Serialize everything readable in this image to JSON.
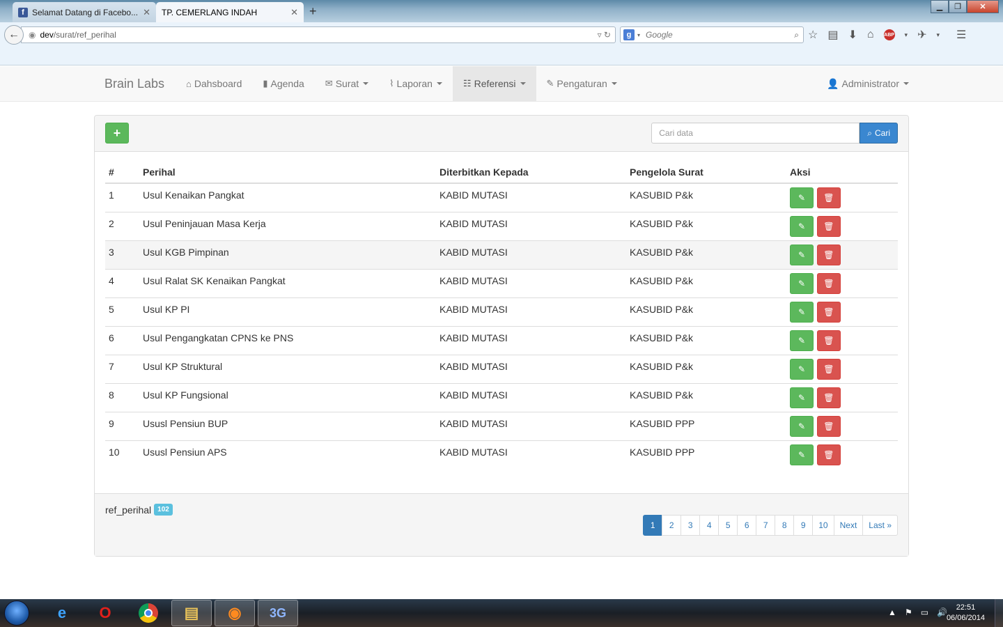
{
  "browser": {
    "tabs": [
      {
        "title": "Selamat Datang di Facebo...",
        "favicon": "facebook-icon"
      },
      {
        "title": "TP. CEMERLANG INDAH"
      }
    ],
    "new_tab": "+",
    "url_host": "dev",
    "url_path": "/surat/ref_perihal",
    "search_placeholder": "Google"
  },
  "app": {
    "brand": "Brain Labs",
    "nav": [
      {
        "label": "Dahsboard",
        "icon": "home-icon"
      },
      {
        "label": "Agenda",
        "icon": "book-icon"
      },
      {
        "label": "Surat",
        "icon": "envelope-icon",
        "dropdown": true
      },
      {
        "label": "Laporan",
        "icon": "paperclip-icon",
        "dropdown": true
      },
      {
        "label": "Referensi",
        "icon": "list-icon",
        "dropdown": true,
        "active": true
      },
      {
        "label": "Pengaturan",
        "icon": "wrench-icon",
        "dropdown": true
      }
    ],
    "user": "Administrator"
  },
  "toolbar": {
    "add_label": "+",
    "search_placeholder": "Cari data",
    "search_button": "Cari"
  },
  "table": {
    "headers": [
      "#",
      "Perihal",
      "Diterbitkan Kepada",
      "Pengelola Surat",
      "Aksi"
    ],
    "rows": [
      [
        "1",
        "Usul Kenaikan Pangkat",
        "KABID MUTASI",
        "KASUBID P&k"
      ],
      [
        "2",
        "Usul Peninjauan Masa Kerja",
        "KABID MUTASI",
        "KASUBID P&k"
      ],
      [
        "3",
        "Usul KGB Pimpinan",
        "KABID MUTASI",
        "KASUBID P&k"
      ],
      [
        "4",
        "Usul Ralat SK Kenaikan Pangkat",
        "KABID MUTASI",
        "KASUBID P&k"
      ],
      [
        "5",
        "Usul KP PI",
        "KABID MUTASI",
        "KASUBID P&k"
      ],
      [
        "6",
        "Usul Pengangkatan CPNS ke PNS",
        "KABID MUTASI",
        "KASUBID P&k"
      ],
      [
        "7",
        "Usul KP Struktural",
        "KABID MUTASI",
        "KASUBID P&k"
      ],
      [
        "8",
        "Usul KP Fungsional",
        "KABID MUTASI",
        "KASUBID P&k"
      ],
      [
        "9",
        "Ususl Pensiun BUP",
        "KABID MUTASI",
        "KASUBID PPP"
      ],
      [
        "10",
        "Ususl Pensiun APS",
        "KABID MUTASI",
        "KASUBID PPP"
      ]
    ]
  },
  "footer": {
    "label": "ref_perihal",
    "count": "102",
    "pages": [
      "1",
      "2",
      "3",
      "4",
      "5",
      "6",
      "7",
      "8",
      "9",
      "10",
      "Next",
      "Last »"
    ],
    "current_page": "1"
  },
  "taskbar": {
    "time": "22:51",
    "date": "06/06/2014"
  },
  "colors": {
    "success": "#5cb85c",
    "danger": "#d9534f",
    "primary": "#337ab7",
    "info": "#5bc0de"
  }
}
